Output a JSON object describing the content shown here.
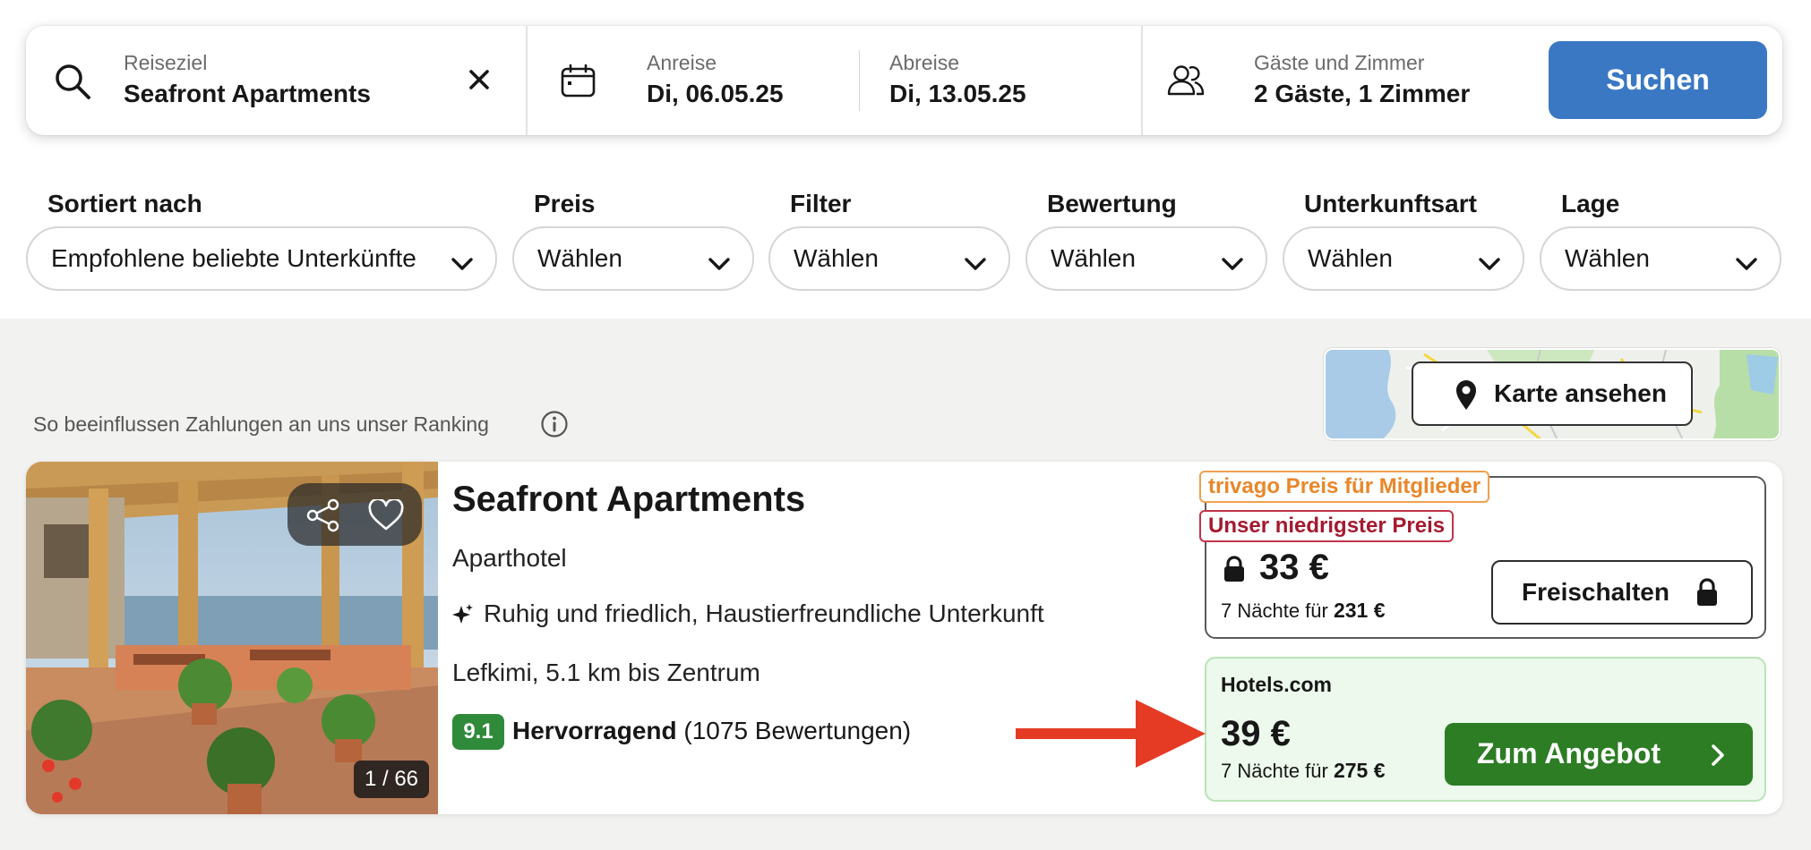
{
  "search": {
    "destination_label": "Reiseziel",
    "destination_value": "Seafront Apartments",
    "checkin_label": "Anreise",
    "checkin_value": "Di, 06.05.25",
    "checkout_label": "Abreise",
    "checkout_value": "Di, 13.05.25",
    "guests_label": "Gäste und Zimmer",
    "guests_value": "2 Gäste, 1 Zimmer",
    "search_button": "Suchen",
    "icons": [
      "search-icon",
      "clear-icon",
      "calendar-icon",
      "guests-icon"
    ]
  },
  "filters": [
    {
      "label": "Sortiert nach",
      "value": "Empfohlene beliebte Unterkünfte"
    },
    {
      "label": "Preis",
      "value": "Wählen"
    },
    {
      "label": "Filter",
      "value": "Wählen"
    },
    {
      "label": "Bewertung",
      "value": "Wählen"
    },
    {
      "label": "Unterkunftsart",
      "value": "Wählen"
    },
    {
      "label": "Lage",
      "value": "Wählen"
    }
  ],
  "map": {
    "button_label": "Karte ansehen"
  },
  "ranking_note": "So beeinflussen Zahlungen an uns unser Ranking",
  "hotel": {
    "name": "Seafront Apartments",
    "type": "Aparthotel",
    "features": "Ruhig und friedlich, Haustierfreundliche Unterkunft",
    "location": "Lefkimi, 5.1 km bis Zentrum",
    "rating_score": "9.1",
    "rating_word": "Hervorragend",
    "rating_count": "(1075 Bewertungen)",
    "photo_counter": "1 / 66"
  },
  "member_offer": {
    "tag_member": "trivago Preis für Mitglieder",
    "tag_lowest": "Unser niedrigster Preis",
    "price": "33 €",
    "nights_prefix": "7 Nächte für",
    "nights_total": "231 €",
    "unlock_button": "Freischalten"
  },
  "deal": {
    "provider": "Hotels.com",
    "price": "39 €",
    "nights_prefix": "7 Nächte für",
    "nights_total": "275 €",
    "button": "Zum Angebot"
  },
  "colors": {
    "search_button": "#3b78c4",
    "deal_button": "#2c7d24",
    "rating_badge": "#2f8a3a",
    "member_tag": "#e8872a",
    "lowest_tag": "#a4192f",
    "arrow": "#e53a24"
  }
}
